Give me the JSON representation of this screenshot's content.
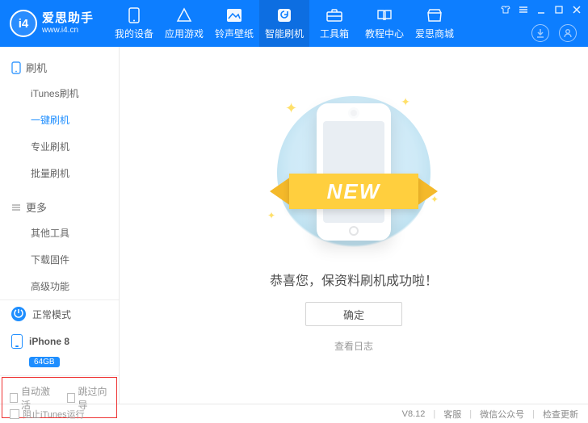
{
  "logo": {
    "mark": "i4",
    "title": "爱思助手",
    "subtitle": "www.i4.cn"
  },
  "nav": {
    "items": [
      {
        "label": "我的设备"
      },
      {
        "label": "应用游戏"
      },
      {
        "label": "铃声壁纸"
      },
      {
        "label": "智能刷机"
      },
      {
        "label": "工具箱"
      },
      {
        "label": "教程中心"
      },
      {
        "label": "爱思商城"
      }
    ]
  },
  "sidebar": {
    "group1": "刷机",
    "items1": [
      {
        "label": "iTunes刷机"
      },
      {
        "label": "一键刷机"
      },
      {
        "label": "专业刷机"
      },
      {
        "label": "批量刷机"
      }
    ],
    "group2": "更多",
    "items2": [
      {
        "label": "其他工具"
      },
      {
        "label": "下载固件"
      },
      {
        "label": "高级功能"
      }
    ],
    "mode": "正常模式",
    "device_name": "iPhone 8",
    "capacity": "64GB",
    "auto_activate": "自动激活",
    "skip_guide": "跳过向导"
  },
  "content": {
    "ribbon": "NEW",
    "success": "恭喜您，保资料刷机成功啦！",
    "ok": "确定",
    "view_log": "查看日志"
  },
  "statusbar": {
    "block_itunes": "阻止iTunes运行",
    "version": "V8.12",
    "support": "客服",
    "wechat": "微信公众号",
    "update": "检查更新"
  }
}
